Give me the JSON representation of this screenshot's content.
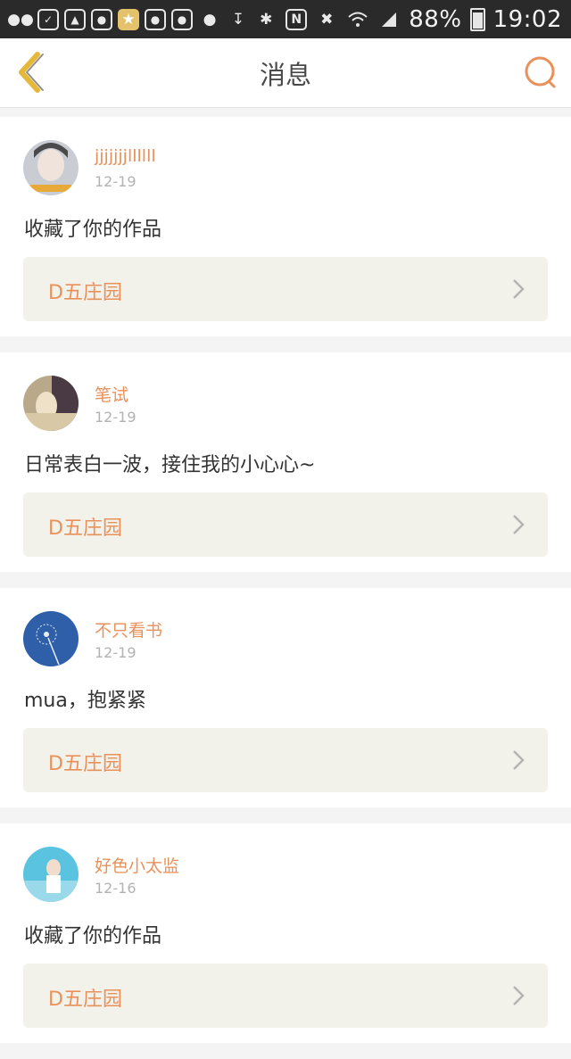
{
  "status_bar": {
    "battery": "88%",
    "time": "19:02"
  },
  "nav": {
    "title": "消息"
  },
  "messages": [
    {
      "username": "jjjjjjjllllll",
      "date": "12-19",
      "text": "收藏了你的作品",
      "work": "D五庄园",
      "avatar": "avatar-girl-light"
    },
    {
      "username": "笔试",
      "date": "12-19",
      "text": "日常表白一波，接住我的小心心~",
      "work": "D五庄园",
      "avatar": "avatar-girl-hand"
    },
    {
      "username": "不只看书",
      "date": "12-19",
      "text": "mua，抱紧紧",
      "work": "D五庄园",
      "avatar": "avatar-dandelion"
    },
    {
      "username": "好色小太监",
      "date": "12-16",
      "text": "收藏了你的作品",
      "work": "D五庄园",
      "avatar": "avatar-girl-pool"
    }
  ],
  "colors": {
    "accent": "#e8915a",
    "back_icon": "#e5b83a",
    "card_work_bg": "#f2f1ea"
  },
  "icons": {
    "back": "chevron-left-icon",
    "search": "search-icon",
    "arrow": "chevron-right-icon"
  }
}
